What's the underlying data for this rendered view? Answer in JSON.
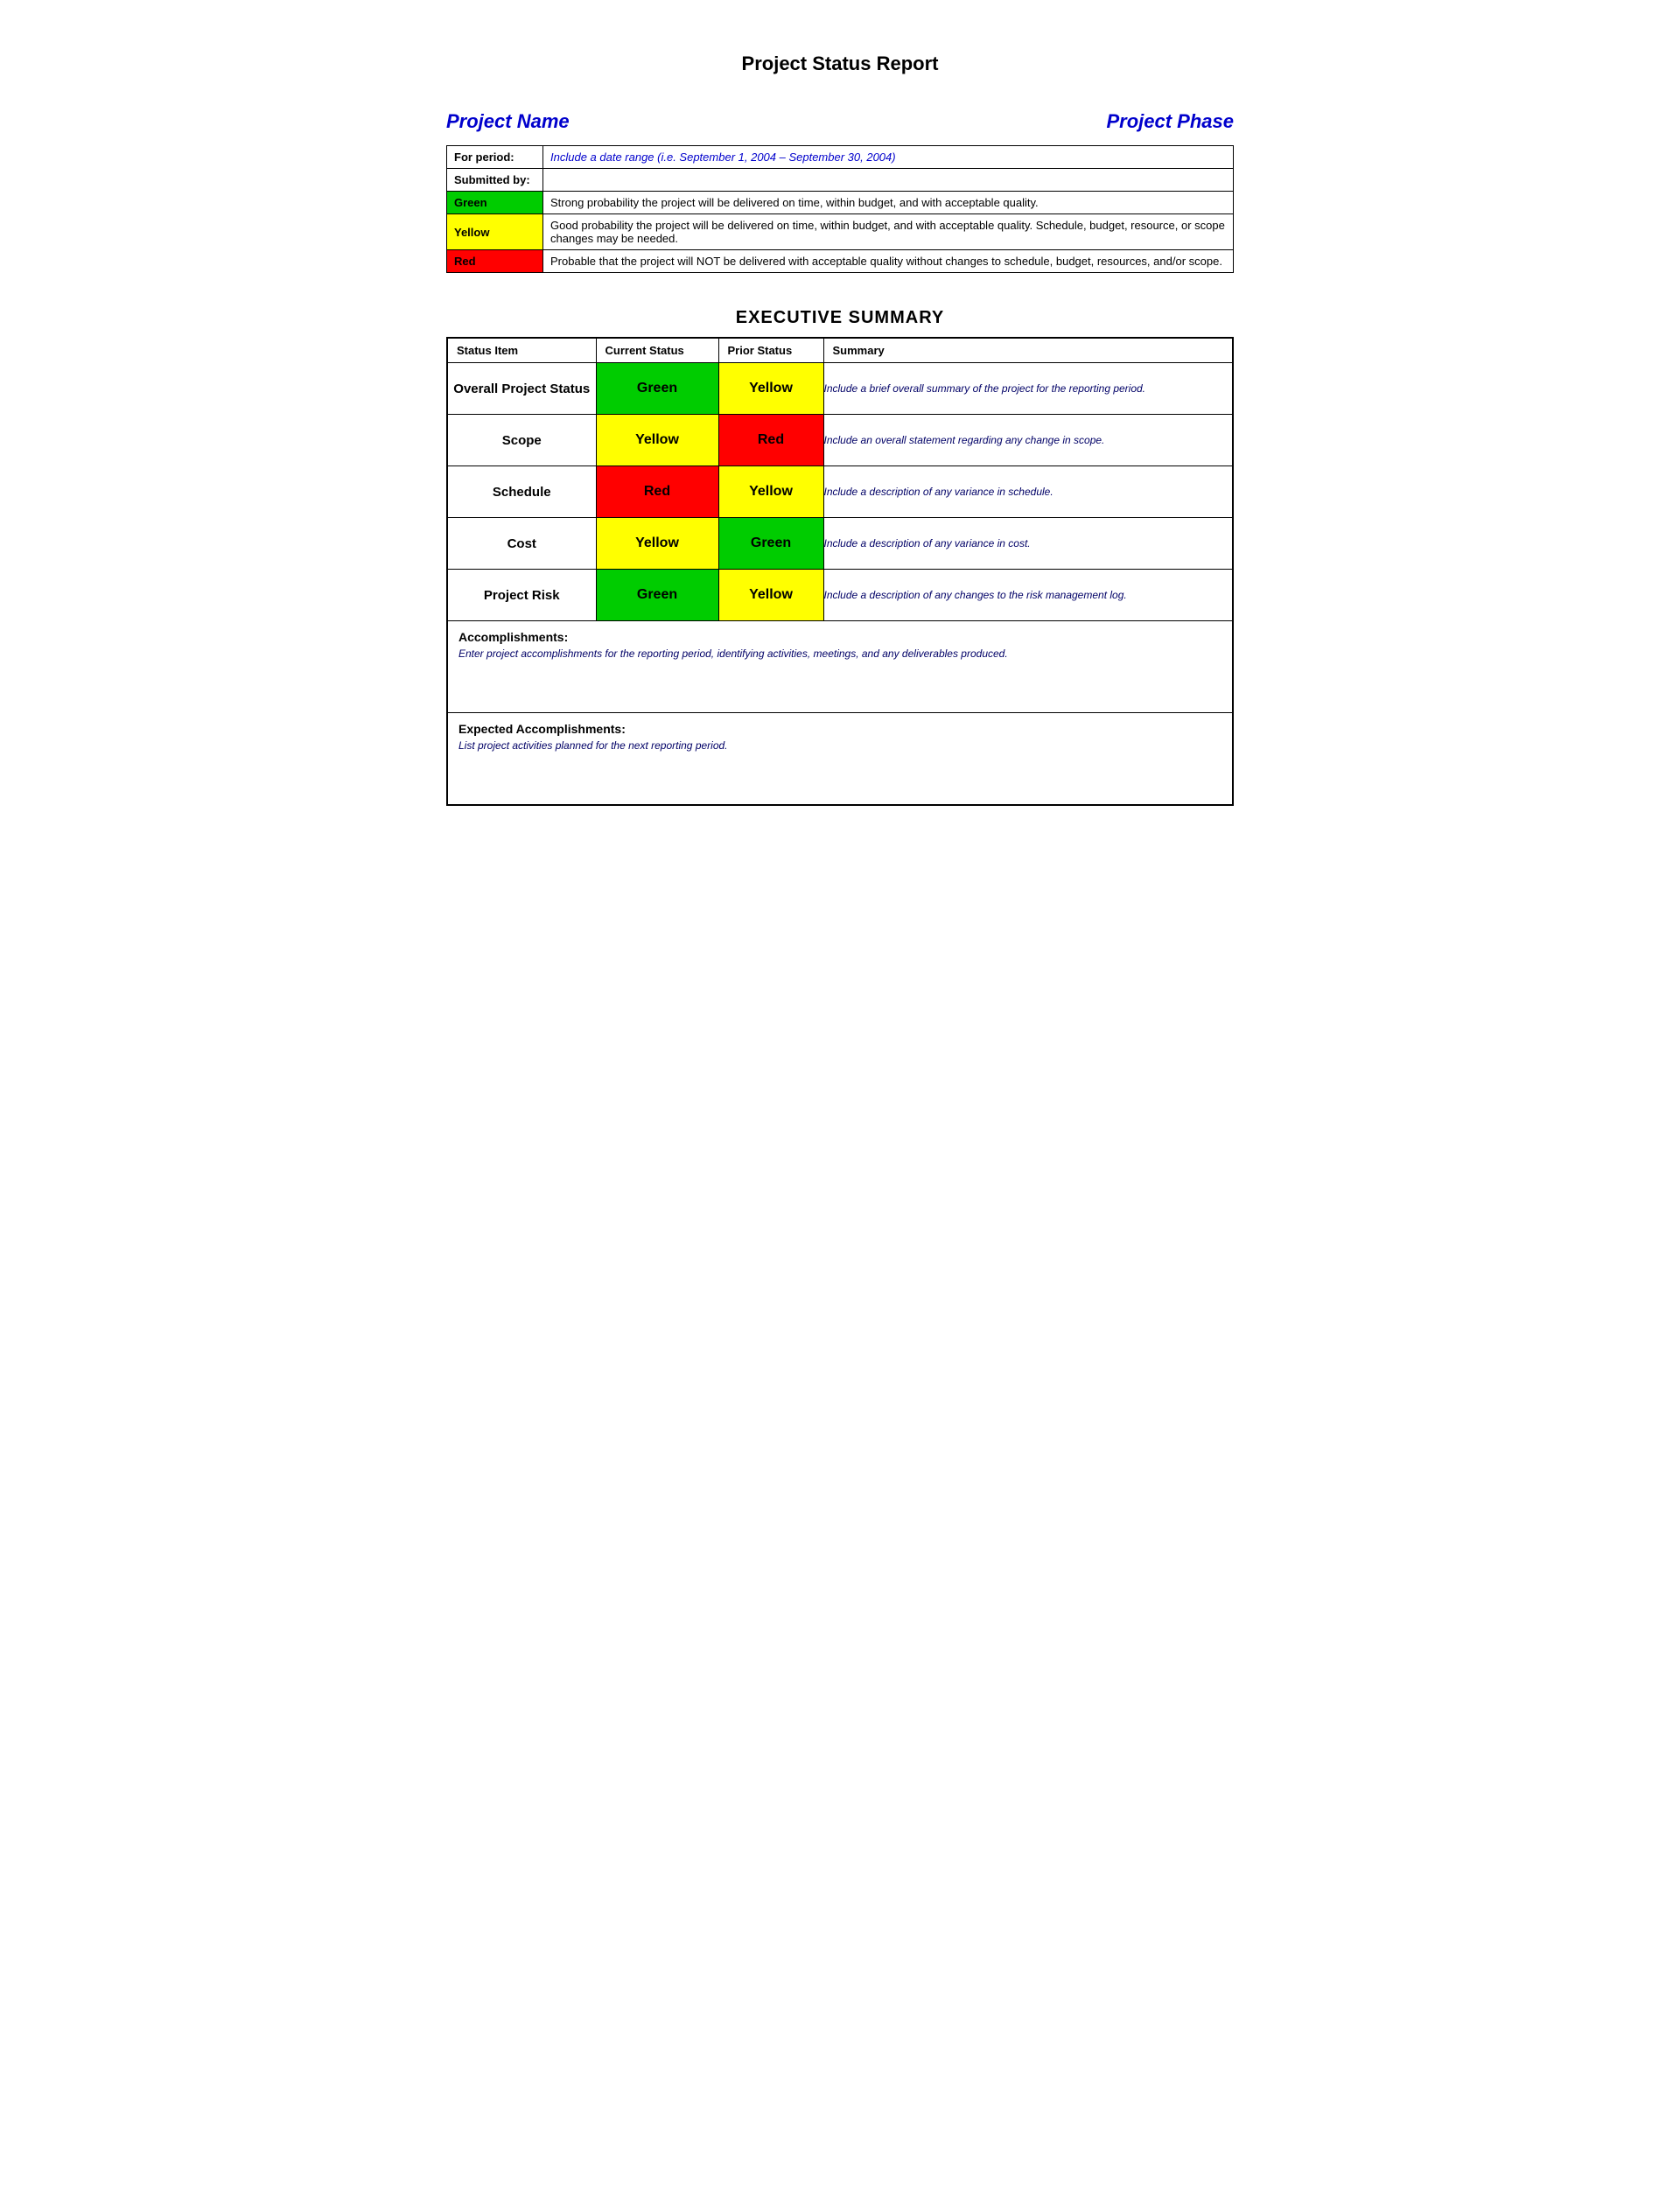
{
  "page": {
    "title": "Project Status Report",
    "project_name_label": "Project Name",
    "project_phase_label": "Project Phase",
    "info_table": {
      "for_period_label": "For period:",
      "for_period_value": "Include a date range (i.e. September 1, 2004 – September 30, 2004)",
      "submitted_by_label": "Submitted by:",
      "submitted_by_value": "",
      "status_rows": [
        {
          "color": "Green",
          "bg": "#00cc00",
          "description": "Strong probability the project will be delivered on time, within budget, and with acceptable quality."
        },
        {
          "color": "Yellow",
          "bg": "#ffff00",
          "description": "Good probability the project will be delivered on time, within budget, and with acceptable quality. Schedule, budget, resource, or scope changes may be needed."
        },
        {
          "color": "Red",
          "bg": "#ff0000",
          "description": "Probable that the project will NOT be delivered with acceptable quality without changes to schedule, budget, resources, and/or scope."
        }
      ]
    },
    "executive_summary": {
      "title": "EXECUTIVE SUMMARY",
      "columns": [
        "Status Item",
        "Current Status",
        "Prior Status",
        "Summary"
      ],
      "rows": [
        {
          "item": "Overall Project Status",
          "current": "Green",
          "current_bg": "#00cc00",
          "prior": "Yellow",
          "prior_bg": "#ffff00",
          "summary": "Include a brief overall summary of the project for the reporting period."
        },
        {
          "item": "Scope",
          "current": "Yellow",
          "current_bg": "#ffff00",
          "prior": "Red",
          "prior_bg": "#ff0000",
          "summary": "Include an overall statement regarding any change in scope."
        },
        {
          "item": "Schedule",
          "current": "Red",
          "current_bg": "#ff0000",
          "prior": "Yellow",
          "prior_bg": "#ffff00",
          "summary": "Include a description of any variance in schedule."
        },
        {
          "item": "Cost",
          "current": "Yellow",
          "current_bg": "#ffff00",
          "prior": "Green",
          "prior_bg": "#00cc00",
          "summary": "Include a description of any variance in cost."
        },
        {
          "item": "Project Risk",
          "current": "Green",
          "current_bg": "#00cc00",
          "prior": "Yellow",
          "prior_bg": "#ffff00",
          "summary": "Include a description of any changes to the risk management log."
        }
      ],
      "accomplishments_label": "Accomplishments:",
      "accomplishments_text": "Enter project accomplishments for the reporting period, identifying activities, meetings, and any deliverables produced.",
      "expected_label": "Expected Accomplishments:",
      "expected_text": "List project activities planned for the next reporting period."
    }
  }
}
